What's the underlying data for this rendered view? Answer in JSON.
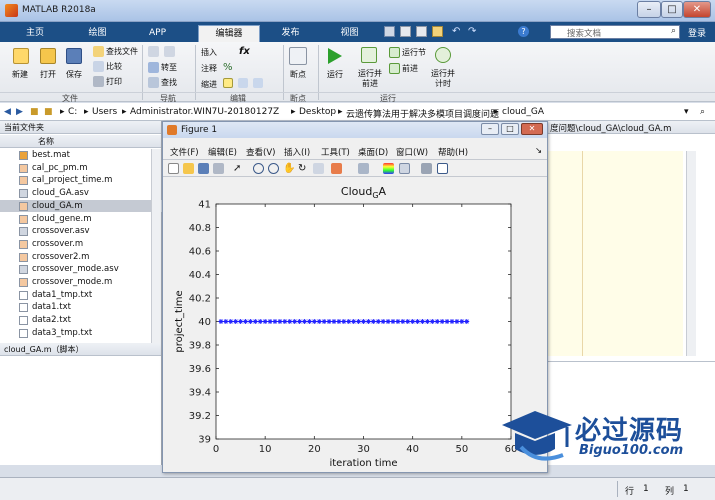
{
  "app": {
    "title": "MATLAB R2018a"
  },
  "tabs": [
    "主页",
    "绘图",
    "APP",
    "编辑器",
    "发布",
    "视图"
  ],
  "search": {
    "placeholder": "搜索文档",
    "signin": "登录"
  },
  "ribbon": {
    "new": "新建",
    "open": "打开",
    "save": "保存",
    "find_files": "查找文件",
    "compare": "比较",
    "print": "打印",
    "goto": "转至",
    "find": "查找",
    "insert": "插入",
    "comment": "注释",
    "indent": "缩进",
    "fx": "fx",
    "breakpoints": "断点",
    "run": "运行",
    "run_advance": "运行并前进",
    "run_section": "运行节",
    "advance": "前进",
    "run_time": "运行并计时",
    "groups": [
      "文件",
      "导航",
      "编辑",
      "断点",
      "运行"
    ]
  },
  "address": {
    "parts": [
      "C:",
      "Users",
      "Administrator.WIN7U-20180127Z",
      "Desktop",
      "云遗传算法用于解决多模项目调度问题",
      "cloud_GA"
    ]
  },
  "current_folder": {
    "title": "当前文件夹",
    "col": "名称",
    "files": [
      {
        "name": "best.mat",
        "kind": "mat"
      },
      {
        "name": "cal_pc_pm.m",
        "kind": "m"
      },
      {
        "name": "cal_project_time.m",
        "kind": "m"
      },
      {
        "name": "cloud_GA.asv",
        "kind": "asv"
      },
      {
        "name": "cloud_GA.m",
        "kind": "m",
        "selected": true
      },
      {
        "name": "cloud_gene.m",
        "kind": "m"
      },
      {
        "name": "crossover.asv",
        "kind": "asv"
      },
      {
        "name": "crossover.m",
        "kind": "m"
      },
      {
        "name": "crossover2.m",
        "kind": "m"
      },
      {
        "name": "crossover_mode.asv",
        "kind": "asv"
      },
      {
        "name": "crossover_mode.m",
        "kind": "m"
      },
      {
        "name": "data1_tmp.txt",
        "kind": "txt"
      },
      {
        "name": "data1.txt",
        "kind": "txt"
      },
      {
        "name": "data2.txt",
        "kind": "txt"
      },
      {
        "name": "data3_tmp.txt",
        "kind": "txt"
      }
    ],
    "detail": "cloud_GA.m（脚本）"
  },
  "editor": {
    "tab_text": "度问题\\cloud_GA\\cloud_GA.m"
  },
  "figure": {
    "title": "Figure 1",
    "menu": [
      "文件(F)",
      "编辑(E)",
      "查看(V)",
      "插入(I)",
      "工具(T)",
      "桌面(D)",
      "窗口(W)",
      "帮助(H)"
    ]
  },
  "chart_data": {
    "type": "line",
    "title_main": "Cloud",
    "title_sub": "G",
    "title_end": "A",
    "xlabel": "iteration time",
    "ylabel": "project_time",
    "xlim": [
      0,
      60
    ],
    "ylim": [
      39,
      41
    ],
    "xticks": [
      0,
      10,
      20,
      30,
      40,
      50,
      60
    ],
    "yticks": [
      39,
      39.2,
      39.4,
      39.6,
      39.8,
      40,
      40.2,
      40.4,
      40.6,
      40.8,
      41
    ],
    "x": [
      1,
      2,
      3,
      4,
      5,
      6,
      7,
      8,
      9,
      10,
      11,
      12,
      13,
      14,
      15,
      16,
      17,
      18,
      19,
      20,
      21,
      22,
      23,
      24,
      25,
      26,
      27,
      28,
      29,
      30,
      31,
      32,
      33,
      34,
      35,
      36,
      37,
      38,
      39,
      40,
      41,
      42,
      43,
      44,
      45,
      46,
      47,
      48,
      49,
      50,
      51
    ],
    "y": [
      40,
      40,
      40,
      40,
      40,
      40,
      40,
      40,
      40,
      40,
      40,
      40,
      40,
      40,
      40,
      40,
      40,
      40,
      40,
      40,
      40,
      40,
      40,
      40,
      40,
      40,
      40,
      40,
      40,
      40,
      40,
      40,
      40,
      40,
      40,
      40,
      40,
      40,
      40,
      40,
      40,
      40,
      40,
      40,
      40,
      40,
      40,
      40,
      40,
      40,
      40
    ],
    "marker": "*",
    "color": "#1f1fff",
    "grid": false
  },
  "watermark": {
    "cn": "必过源码",
    "url": "Biguo100.com"
  },
  "status": {
    "row_label": "行",
    "row": "1",
    "col_label": "列",
    "col": "1"
  }
}
